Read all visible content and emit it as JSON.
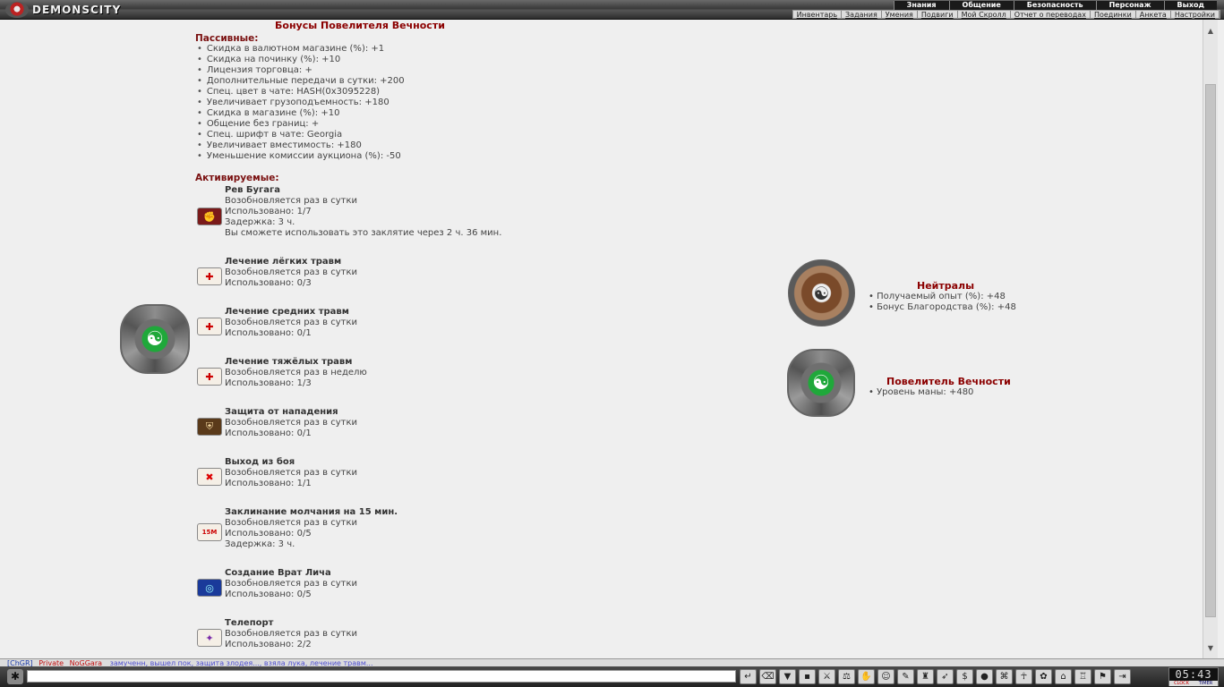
{
  "app": {
    "logo_text": "DEMONSCITY"
  },
  "main_nav": [
    "Знания",
    "Общение",
    "Безопасность",
    "Персонаж",
    "Выход"
  ],
  "sub_nav": [
    "Инвентарь",
    "Задания",
    "Умения",
    "Подвиги",
    "Мой Скролл",
    "Отчет о переводах",
    "Поединки",
    "Анкета",
    "Настройки"
  ],
  "page": {
    "title": "Бонусы Повелителя Вечности",
    "passive_heading": "Пассивные:",
    "passive": [
      "Скидка в валютном магазине (%): +1",
      "Скидка на починку (%): +10",
      "Лицензия торговца: +",
      "Дополнительные передачи в сутки: +200",
      "Спец. цвет в чате: HASH(0x3095228)",
      "Увеличивает грузоподъемность: +180",
      "Скидка в магазине (%): +10",
      "Общение без границ: +",
      "Спец. шрифт в чате: Georgia",
      "Увеличивает вместимость: +180",
      "Уменьшение комиссии аукциона (%): -50"
    ],
    "active_heading": "Активируемые:",
    "skills": [
      {
        "name": "Рев Бугага",
        "lines": [
          "Возобновляется раз в сутки",
          "Использовано: 1/7",
          "Задержка: 3 ч.",
          "Вы сможете использовать это заклятие через 2 ч. 36 мин."
        ],
        "icon": "roar-icon"
      },
      {
        "name": "Лечение лёгких травм",
        "lines": [
          "Возобновляется раз в сутки",
          "Использовано: 0/3"
        ],
        "icon": "heal-scroll-icon"
      },
      {
        "name": "Лечение средних травм",
        "lines": [
          "Возобновляется раз в сутки",
          "Использовано: 0/1"
        ],
        "icon": "heal-scroll-icon"
      },
      {
        "name": "Лечение тяжёлых травм",
        "lines": [
          "Возобновляется раз в неделю",
          "Использовано: 1/3"
        ],
        "icon": "heal-scroll-icon"
      },
      {
        "name": "Защита от нападения",
        "lines": [
          "Возобновляется раз в сутки",
          "Использовано: 0/1"
        ],
        "icon": "shield-scroll-icon"
      },
      {
        "name": "Выход из боя",
        "lines": [
          "Возобновляется раз в сутки",
          "Использовано: 1/1"
        ],
        "icon": "exit-battle-icon"
      },
      {
        "name": "Заклинание молчания на 15 мин.",
        "lines": [
          "Возобновляется раз в сутки",
          "Использовано: 0/5",
          "Задержка: 3 ч."
        ],
        "icon": "silence-icon",
        "badge": "15M"
      },
      {
        "name": "Создание Врат Лича",
        "lines": [
          "Возобновляется раз в сутки",
          "Использовано: 0/5"
        ],
        "icon": "lich-gate-icon"
      },
      {
        "name": "Телепорт",
        "lines": [
          "Возобновляется раз в сутки",
          "Использовано: 2/2"
        ],
        "icon": "teleport-icon"
      }
    ]
  },
  "factions": [
    {
      "name": "Нейтралы",
      "bonuses": [
        "Получаемый опыт (%): +48",
        "Бонус Благородства (%): +48"
      ],
      "icon": "neutral-medal-icon"
    },
    {
      "name": "Повелитель Вечности",
      "bonuses": [
        "Уровень маны: +480"
      ],
      "icon": "eternity-gear-icon"
    }
  ],
  "chat": {
    "line_parts": [
      "[ChGR]",
      "Private",
      "NoGGara",
      "замученн, вышел пок, защита злодея..., взяла лука, лечение травм..."
    ]
  },
  "clock": {
    "time": "05:43",
    "tab_clock": "CLOCK",
    "tab_timer": "TIMER"
  }
}
